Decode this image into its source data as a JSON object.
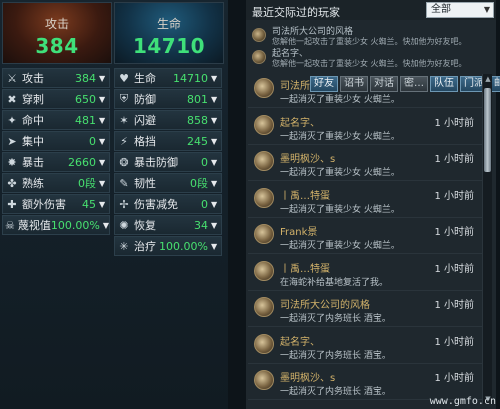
{
  "stats": {
    "attack_card": {
      "label": "攻击",
      "value": "384"
    },
    "life_card": {
      "label": "生命",
      "value": "14710"
    },
    "left_column": [
      {
        "icon": "crossed-swords-icon",
        "glyph": "⚔",
        "label": "攻击",
        "value": "384"
      },
      {
        "icon": "pierce-icon",
        "glyph": "✖",
        "label": "穿刺",
        "value": "650"
      },
      {
        "icon": "hit-icon",
        "glyph": "✦",
        "label": "命中",
        "value": "481"
      },
      {
        "icon": "focus-icon",
        "glyph": "➤",
        "label": "集中",
        "value": "0"
      },
      {
        "icon": "critical-icon",
        "glyph": "✸",
        "label": "暴击",
        "value": "2660"
      },
      {
        "icon": "mastery-icon",
        "glyph": "✤",
        "label": "熟练",
        "value": "0段"
      },
      {
        "icon": "extra-damage-icon",
        "glyph": "✚",
        "label": "额外伤害",
        "value": "45"
      },
      {
        "icon": "skull-icon",
        "glyph": "☠",
        "label": "蔑视值",
        "value": "100.00%"
      }
    ],
    "right_column": [
      {
        "icon": "heart-icon",
        "glyph": "♥",
        "label": "生命",
        "value": "14710"
      },
      {
        "icon": "shield-icon",
        "glyph": "⛨",
        "label": "防御",
        "value": "801"
      },
      {
        "icon": "evade-icon",
        "glyph": "✶",
        "label": "闪避",
        "value": "858"
      },
      {
        "icon": "block-icon",
        "glyph": "⚡",
        "label": "格挡",
        "value": "245"
      },
      {
        "icon": "crit-defense-icon",
        "glyph": "❂",
        "label": "暴击防御",
        "value": "0"
      },
      {
        "icon": "toughness-icon",
        "glyph": "✎",
        "label": "韧性",
        "value": "0段"
      },
      {
        "icon": "damage-reduction-icon",
        "glyph": "✢",
        "label": "伤害减免",
        "value": "0"
      },
      {
        "icon": "recovery-icon",
        "glyph": "✺",
        "label": "恢复",
        "value": "34"
      },
      {
        "icon": "heal-icon",
        "glyph": "✳",
        "label": "治疗",
        "value": "100.00%"
      }
    ]
  },
  "players": {
    "title": "最近交际过的玩家",
    "filter": {
      "selected": "全部"
    },
    "recent": [
      {
        "name": "司法所大公司的风格",
        "desc": "您解他一起攻击了重装少女 火蜘兰。快加他为好友吧。"
      },
      {
        "name": "起名字、",
        "desc": "您解他一起攻击了重装少女 火蜘兰。快加他为好友吧。"
      }
    ],
    "context_menu": [
      "好友",
      "诏书",
      "对话",
      "密…",
      "队伍",
      "门派",
      "邮件"
    ],
    "list": [
      {
        "name": "司法所",
        "time": "",
        "desc": "一起消灭了重装少女 火蜘兰。"
      },
      {
        "name": "起名字、",
        "time": "1 小时前",
        "desc": "一起消灭了重装少女 火蜘兰。"
      },
      {
        "name": "墨明枫沙、s",
        "time": "1 小时前",
        "desc": "一起消灭了重装少女 火蜘兰。"
      },
      {
        "name": "丨禹…特蛋",
        "time": "1 小时前",
        "desc": "一起消灭了重装少女 火蜘兰。"
      },
      {
        "name": "Frank景",
        "time": "1 小时前",
        "desc": "一起消灭了重装少女 火蜘兰。"
      },
      {
        "name": "丨禹…特蛋",
        "time": "1 小时前",
        "desc": "在海蛇补给基地复活了我。"
      },
      {
        "name": "司法所大公司的风格",
        "time": "1 小时前",
        "desc": "一起消灭了内务班长 酒宝。"
      },
      {
        "name": "起名字、",
        "time": "1 小时前",
        "desc": "一起消灭了内务班长 酒宝。"
      },
      {
        "name": "墨明枫沙、s",
        "time": "1 小时前",
        "desc": "一起消灭了内务班长 酒宝。"
      }
    ]
  },
  "watermark": "www.gmfo.cn",
  "colors": {
    "stat_value": "#47e06f",
    "player_name": "#d2b26a",
    "accent_button": "#3d6a8a"
  }
}
